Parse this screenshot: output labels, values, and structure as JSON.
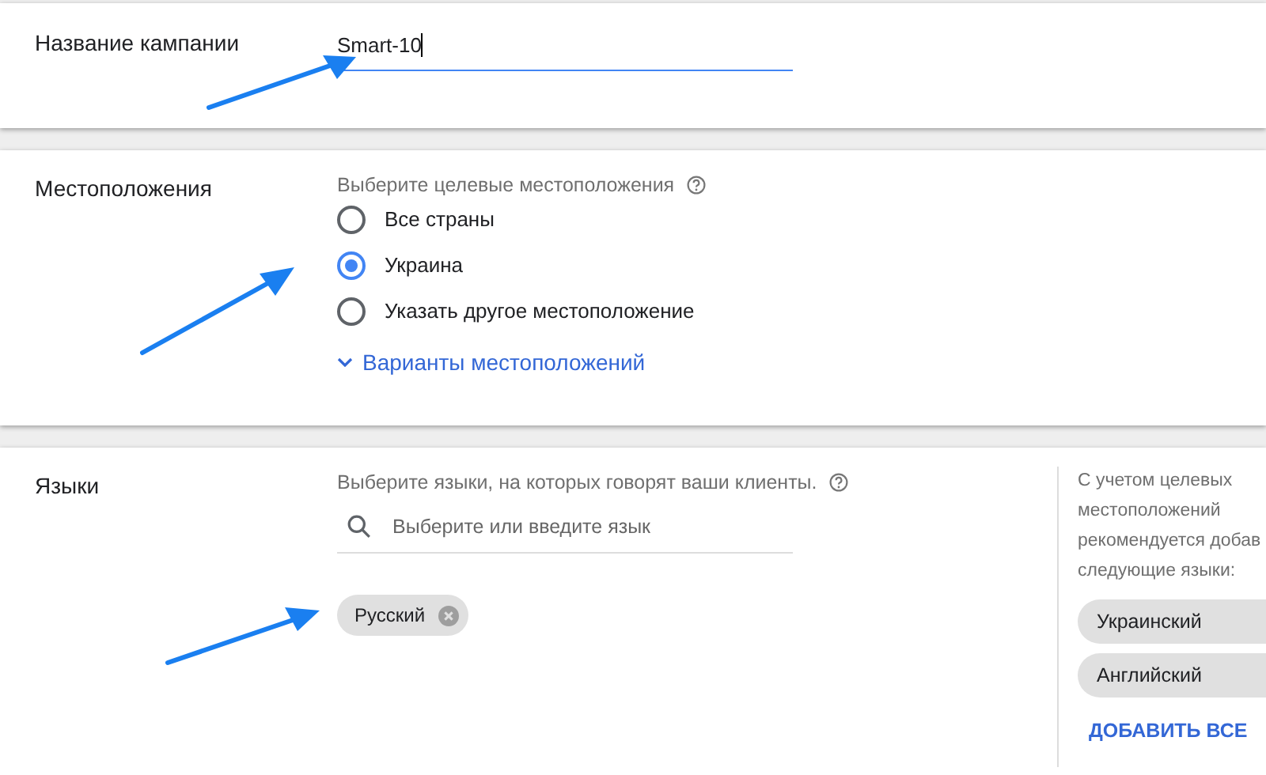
{
  "campaign_name": {
    "label": "Название кампании",
    "value": "Smart-10"
  },
  "locations": {
    "label": "Местоположения",
    "prompt": "Выберите целевые местоположения",
    "options": [
      {
        "label": "Все страны",
        "selected": false
      },
      {
        "label": "Украина",
        "selected": true
      },
      {
        "label": "Указать другое местоположение",
        "selected": false
      }
    ],
    "more_link": "Варианты местоположений"
  },
  "languages": {
    "label": "Языки",
    "prompt": "Выберите языки, на которых говорят ваши клиенты.",
    "search": {
      "placeholder": "Выберите или введите язык"
    },
    "chips": [
      "Русский"
    ],
    "suggestions": {
      "text_lines": [
        "С учетом целевых",
        "местоположений",
        "рекомендуется добав",
        "следующие языки:"
      ],
      "chips": [
        "Украинский",
        "Английский"
      ],
      "add_all": "ДОБАВИТЬ ВСЕ"
    }
  }
}
